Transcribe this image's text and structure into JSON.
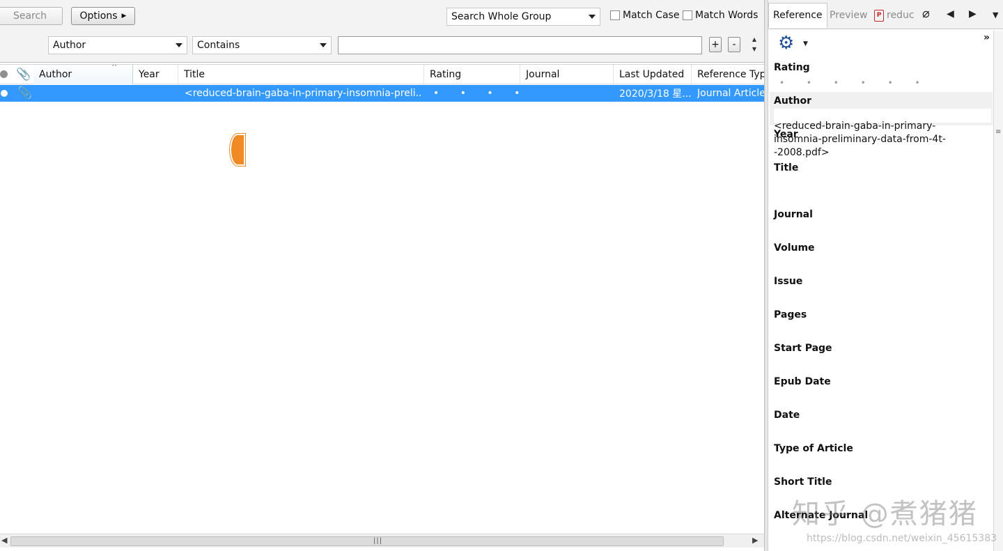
{
  "search_panel": {
    "search_button": "Search",
    "options_button": "Options",
    "scope": "Search Whole Group",
    "match_case": "Match Case",
    "match_words": "Match Words",
    "field": "Author",
    "operator": "Contains",
    "term": "",
    "plus": "+",
    "minus": "-"
  },
  "columns": [
    "Author",
    "Year",
    "Title",
    "Rating",
    "Journal",
    "Last Updated",
    "Reference Typ"
  ],
  "rows": [
    {
      "author": "",
      "year": "",
      "title": "<reduced-brain-gaba-in-primary-insomnia-preli...",
      "rating": "• • • • •",
      "journal": "",
      "last_updated": "2020/3/18 星...",
      "reference_type": "Journal Article"
    }
  ],
  "right_tabs": {
    "reference": "Reference",
    "preview": "Preview",
    "pdf": "reduc"
  },
  "reference_fields": {
    "rating_label": "Rating",
    "rating_value": "• • • • • •",
    "author": "Author",
    "year": "Year",
    "title": "Title",
    "title_value": "<reduced-brain-gaba-in-primary-insomnia-preliminary-data-from-4t--2008.pdf>",
    "journal": "Journal",
    "volume": "Volume",
    "issue": "Issue",
    "pages": "Pages",
    "start_page": "Start Page",
    "epub_date": "Epub Date",
    "date": "Date",
    "type_of_article": "Type of Article",
    "short_title": "Short Title",
    "alternate_journal": "Alternate Journal"
  },
  "watermark": {
    "text": "知乎 @煮猪猪",
    "url": "https://blog.csdn.net/weixin_45615383"
  },
  "colors": {
    "selection": "#3399ff",
    "gear": "#1e4f9c",
    "accent_orange": "#f08a24"
  }
}
